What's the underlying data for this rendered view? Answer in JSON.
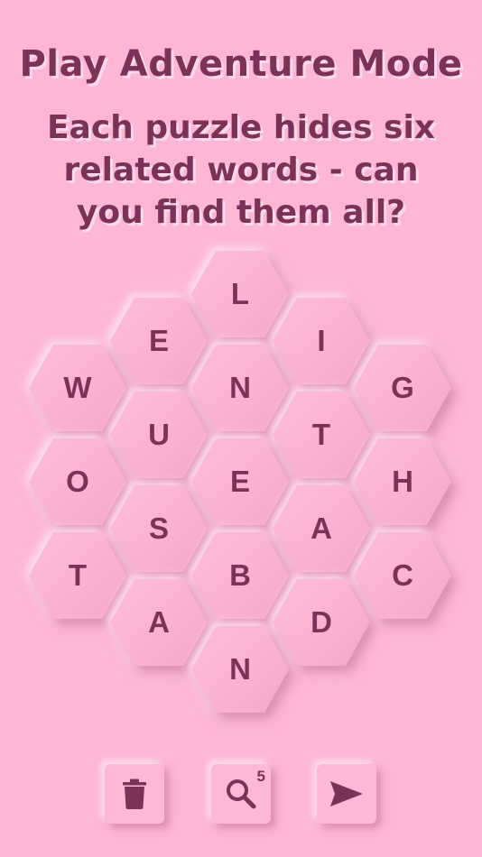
{
  "header": {
    "title": "Play Adventure Mode",
    "subtitle": "Each puzzle hides six related words - can you find them all?"
  },
  "board": {
    "tiles": [
      {
        "letter": "L"
      },
      {
        "letter": "E"
      },
      {
        "letter": "I"
      },
      {
        "letter": "W"
      },
      {
        "letter": "N"
      },
      {
        "letter": "G"
      },
      {
        "letter": "U"
      },
      {
        "letter": "T"
      },
      {
        "letter": "O"
      },
      {
        "letter": "E"
      },
      {
        "letter": "H"
      },
      {
        "letter": "S"
      },
      {
        "letter": "A"
      },
      {
        "letter": "T"
      },
      {
        "letter": "B"
      },
      {
        "letter": "C"
      },
      {
        "letter": "A"
      },
      {
        "letter": "D"
      },
      {
        "letter": "N"
      }
    ]
  },
  "toolbar": {
    "delete_icon": "trash-icon",
    "hint_icon": "magnifier-icon",
    "hint_count": "5",
    "submit_icon": "send-arrow-icon"
  },
  "colors": {
    "background": "#fdb6d6",
    "accent": "#7b3258",
    "text_shadow": "#ffd8ea"
  }
}
